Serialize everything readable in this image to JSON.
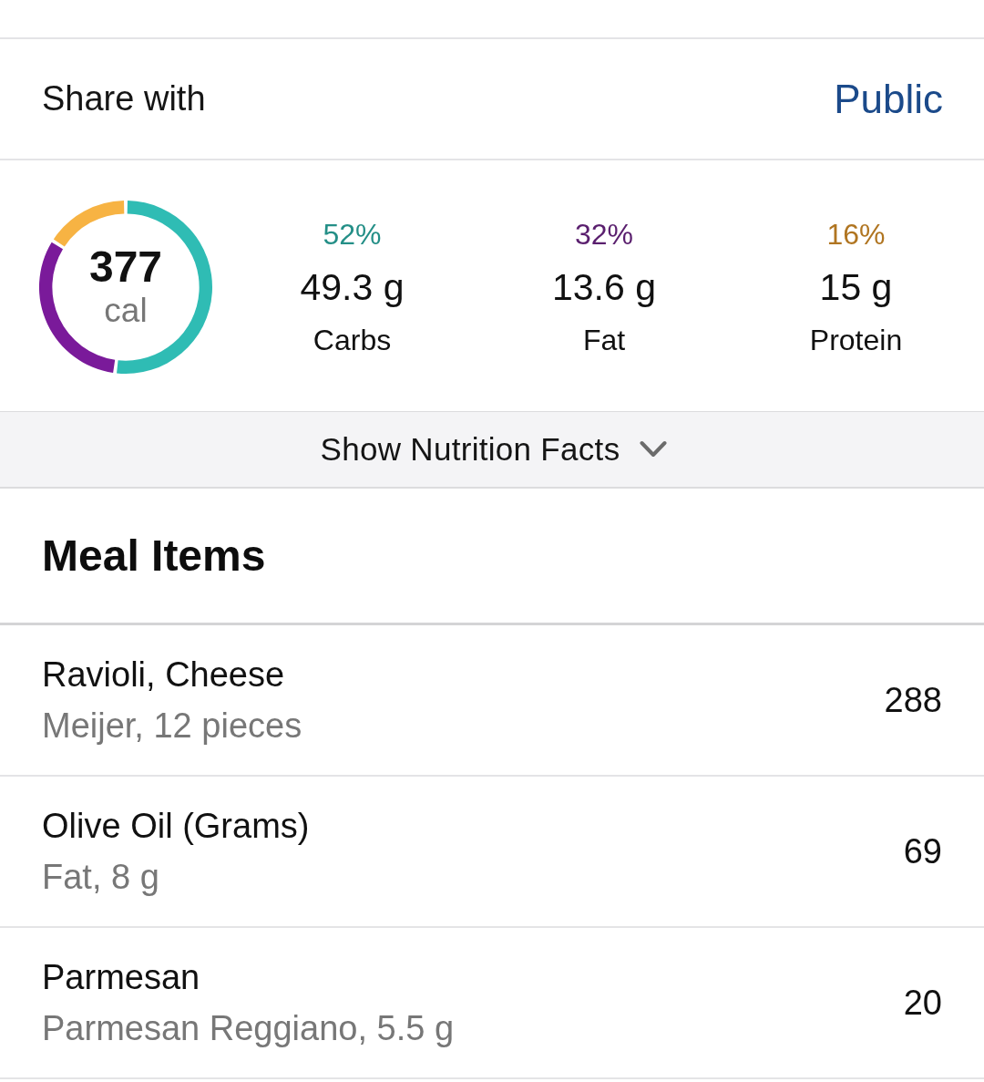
{
  "share": {
    "label": "Share with",
    "value": "Public"
  },
  "summary": {
    "calories": "377",
    "unit": "cal",
    "chart_data": {
      "type": "donut",
      "categories": [
        "Carbs",
        "Fat",
        "Protein"
      ],
      "series": [
        {
          "values": [
            52,
            32,
            16
          ]
        }
      ],
      "colors": [
        "#2fbcb4",
        "#7a1a9a",
        "#f7b343"
      ]
    }
  },
  "macros": [
    {
      "percent": "52%",
      "amount": "49.3 g",
      "color": "#248f87"
    },
    {
      "percent": "32%",
      "amount": "13.6 g",
      "color": "#5a1f6e"
    },
    {
      "percent": "16%",
      "amount": "15 g",
      "color": "#b07521"
    }
  ],
  "nutrition_toggle": {
    "label": "Show Nutrition Facts",
    "expanded": false
  },
  "meal_items": {
    "title": "Meal Items",
    "items": [
      {
        "name": "Ravioli, Cheese",
        "detail": "Meijer, 12 pieces",
        "calories": "288"
      },
      {
        "name": "Olive Oil (Grams)",
        "detail": "Fat, 8 g",
        "calories": "69"
      },
      {
        "name": "Parmesan",
        "detail": "Parmesan Reggiano, 5.5 g",
        "calories": "20"
      }
    ]
  }
}
